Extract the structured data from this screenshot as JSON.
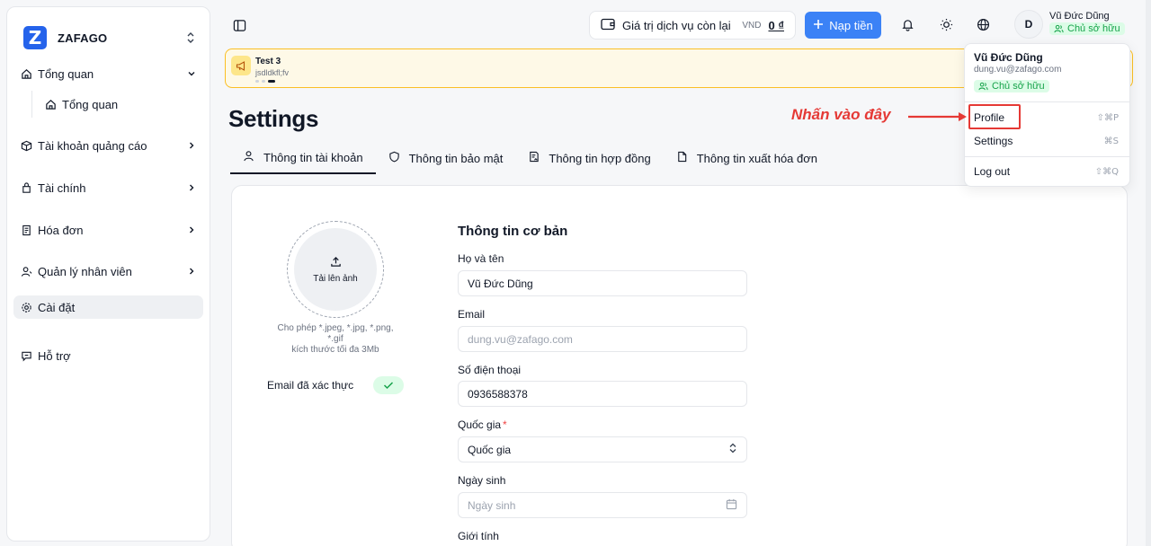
{
  "sidebar": {
    "brand": {
      "logo_letter": "Z",
      "name": "ZAFAGO"
    },
    "items": [
      {
        "label": "Tổng quan",
        "icon": "home-icon"
      },
      {
        "label": "Tổng quan",
        "icon": "home-icon"
      },
      {
        "label": "Tài khoản quảng cáo",
        "icon": "box-icon"
      },
      {
        "label": "Tài chính",
        "icon": "wallet-icon"
      },
      {
        "label": "Hóa đơn",
        "icon": "invoice-icon"
      },
      {
        "label": "Quản lý nhân viên",
        "icon": "user-icon"
      },
      {
        "label": "Cài đặt",
        "icon": "gear-icon"
      },
      {
        "label": "Hỗ trợ",
        "icon": "chat-icon"
      }
    ]
  },
  "topbar": {
    "balance_label": "Giá trị dịch vụ còn lại",
    "currency": "VND",
    "amount": "0 ₫",
    "topup_label": "Nạp tiền",
    "avatar_letter": "D",
    "user_name": "Vũ Đức Dũng",
    "role": "Chủ sở hữu"
  },
  "announcement": {
    "title": "Test 3",
    "body": "jsdldkfl;fv"
  },
  "page": {
    "title": "Settings",
    "tabs": [
      {
        "label": "Thông tin tài khoản",
        "icon": "user-icon"
      },
      {
        "label": "Thông tin bảo mật",
        "icon": "shield-icon"
      },
      {
        "label": "Thông tin hợp đồng",
        "icon": "contract-icon"
      },
      {
        "label": "Thông tin xuất hóa đơn",
        "icon": "file-icon"
      }
    ]
  },
  "profile": {
    "upload_label": "Tải lên ảnh",
    "upload_hint_1": "Cho phép *.jpeg, *.jpg, *.png, *.gif",
    "upload_hint_2": "kích thước tối đa 3Mb",
    "verified_label": "Email đã xác thực",
    "section_title": "Thông tin cơ bản",
    "fields": {
      "name_label": "Họ và tên",
      "name_value": "Vũ Đức Dũng",
      "email_label": "Email",
      "email_value": "dung.vu@zafago.com",
      "phone_label": "Số điện thoại",
      "phone_value": "0936588378",
      "country_label": "Quốc gia",
      "country_required": "*",
      "country_value": "Quốc gia",
      "dob_label": "Ngày sinh",
      "dob_placeholder": "Ngày sinh",
      "gender_label": "Giới tính"
    }
  },
  "user_menu": {
    "name": "Vũ Đức Dũng",
    "email": "dung.vu@zafago.com",
    "role": "Chủ sở hữu",
    "items": [
      {
        "label": "Profile",
        "shortcut": "⇧⌘P"
      },
      {
        "label": "Settings",
        "shortcut": "⌘S"
      },
      {
        "label": "Log out",
        "shortcut": "⇧⌘Q"
      }
    ]
  },
  "annotation": {
    "text": "Nhấn vào đây",
    "color": "#e53935"
  },
  "colors": {
    "primary": "#3b82f6",
    "success": "#16a34a",
    "warning_bg": "#fef9e7"
  }
}
